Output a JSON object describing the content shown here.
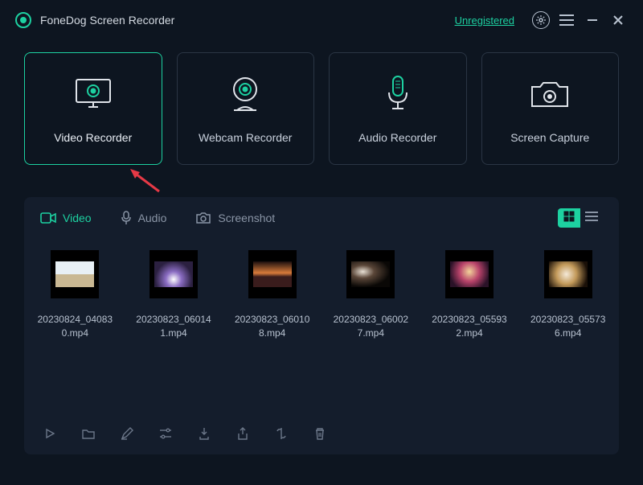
{
  "app": {
    "title": "FoneDog Screen Recorder",
    "status_link": "Unregistered"
  },
  "modes": {
    "video": "Video Recorder",
    "webcam": "Webcam Recorder",
    "audio": "Audio Recorder",
    "capture": "Screen Capture"
  },
  "tabs": {
    "video": "Video",
    "audio": "Audio",
    "screenshot": "Screenshot"
  },
  "recordings": [
    {
      "name": "20230824_040830.mp4"
    },
    {
      "name": "20230823_060141.mp4"
    },
    {
      "name": "20230823_060108.mp4"
    },
    {
      "name": "20230823_060027.mp4"
    },
    {
      "name": "20230823_055932.mp4"
    },
    {
      "name": "20230823_055736.mp4"
    }
  ],
  "colors": {
    "accent": "#1dd1a1"
  }
}
